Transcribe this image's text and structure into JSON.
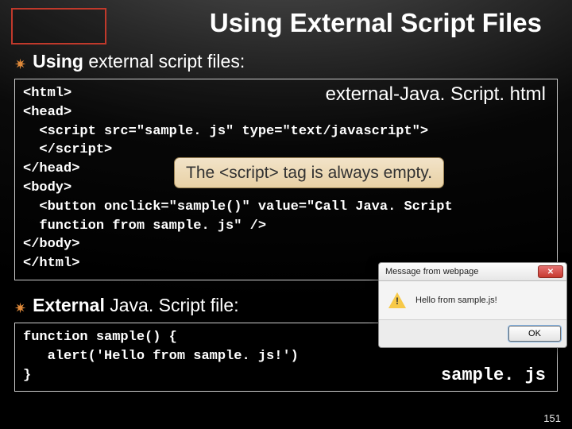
{
  "title": "Using External Script Files",
  "bullets": {
    "b1_prefix": "Using",
    "b1_rest": " external script files:",
    "b2_prefix": "External",
    "b2_rest": " Java. Script file:"
  },
  "code1": {
    "label": "external-Java. Script. html",
    "line1": "<html>",
    "line2": "<head>",
    "line3": "  <script src=\"sample. js\" type=\"text/javascript\">",
    "line4": "  </script>",
    "line5": "</head>",
    "line6": "<body>",
    "line7": "  <button onclick=\"sample()\" value=\"Call Java. Script",
    "line8": "  function from sample. js\" />",
    "line9": "</body>",
    "line10": "</html>"
  },
  "callout": "The <script> tag is always empty.",
  "code2": {
    "label": "sample. js",
    "line1": "function sample() {",
    "line2": "   alert('Hello from sample. js!')",
    "line3": "}"
  },
  "dialog": {
    "title": "Message from webpage",
    "message": "Hello from sample.js!",
    "ok": "OK"
  },
  "page": "151"
}
